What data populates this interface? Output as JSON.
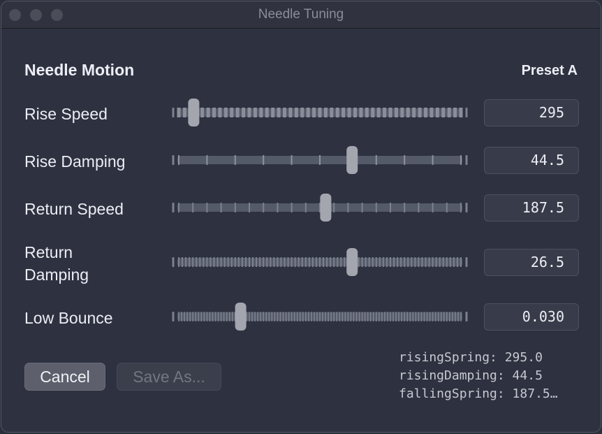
{
  "window": {
    "title": "Needle Tuning"
  },
  "section": {
    "title": "Needle Motion",
    "preset": "Preset A"
  },
  "sliders": [
    {
      "label": "Rise Speed",
      "value": "295",
      "position": 0.07,
      "ticks": 48,
      "tick_style": "dense-blocks"
    },
    {
      "label": "Rise Damping",
      "value": "44.5",
      "position": 0.61,
      "ticks": 10,
      "tick_style": "sparse"
    },
    {
      "label": "Return Speed",
      "value": "187.5",
      "position": 0.52,
      "ticks": 20,
      "tick_style": "medium"
    },
    {
      "label": "Return Damping",
      "value": "26.5",
      "position": 0.61,
      "ticks": 80,
      "tick_style": "dense"
    },
    {
      "label": "Low Bounce",
      "value": "0.030",
      "position": 0.23,
      "ticks": 100,
      "tick_style": "very-dense"
    }
  ],
  "buttons": {
    "cancel": "Cancel",
    "save_as": "Save As..."
  },
  "log": {
    "lines": [
      "risingSpring: 295.0",
      "risingDamping: 44.5",
      "fallingSpring: 187.5…"
    ]
  },
  "colors": {
    "background": "#2d3140",
    "track": "#555a68",
    "tick": "#7d818e",
    "thumb": "#a3a6ae"
  }
}
